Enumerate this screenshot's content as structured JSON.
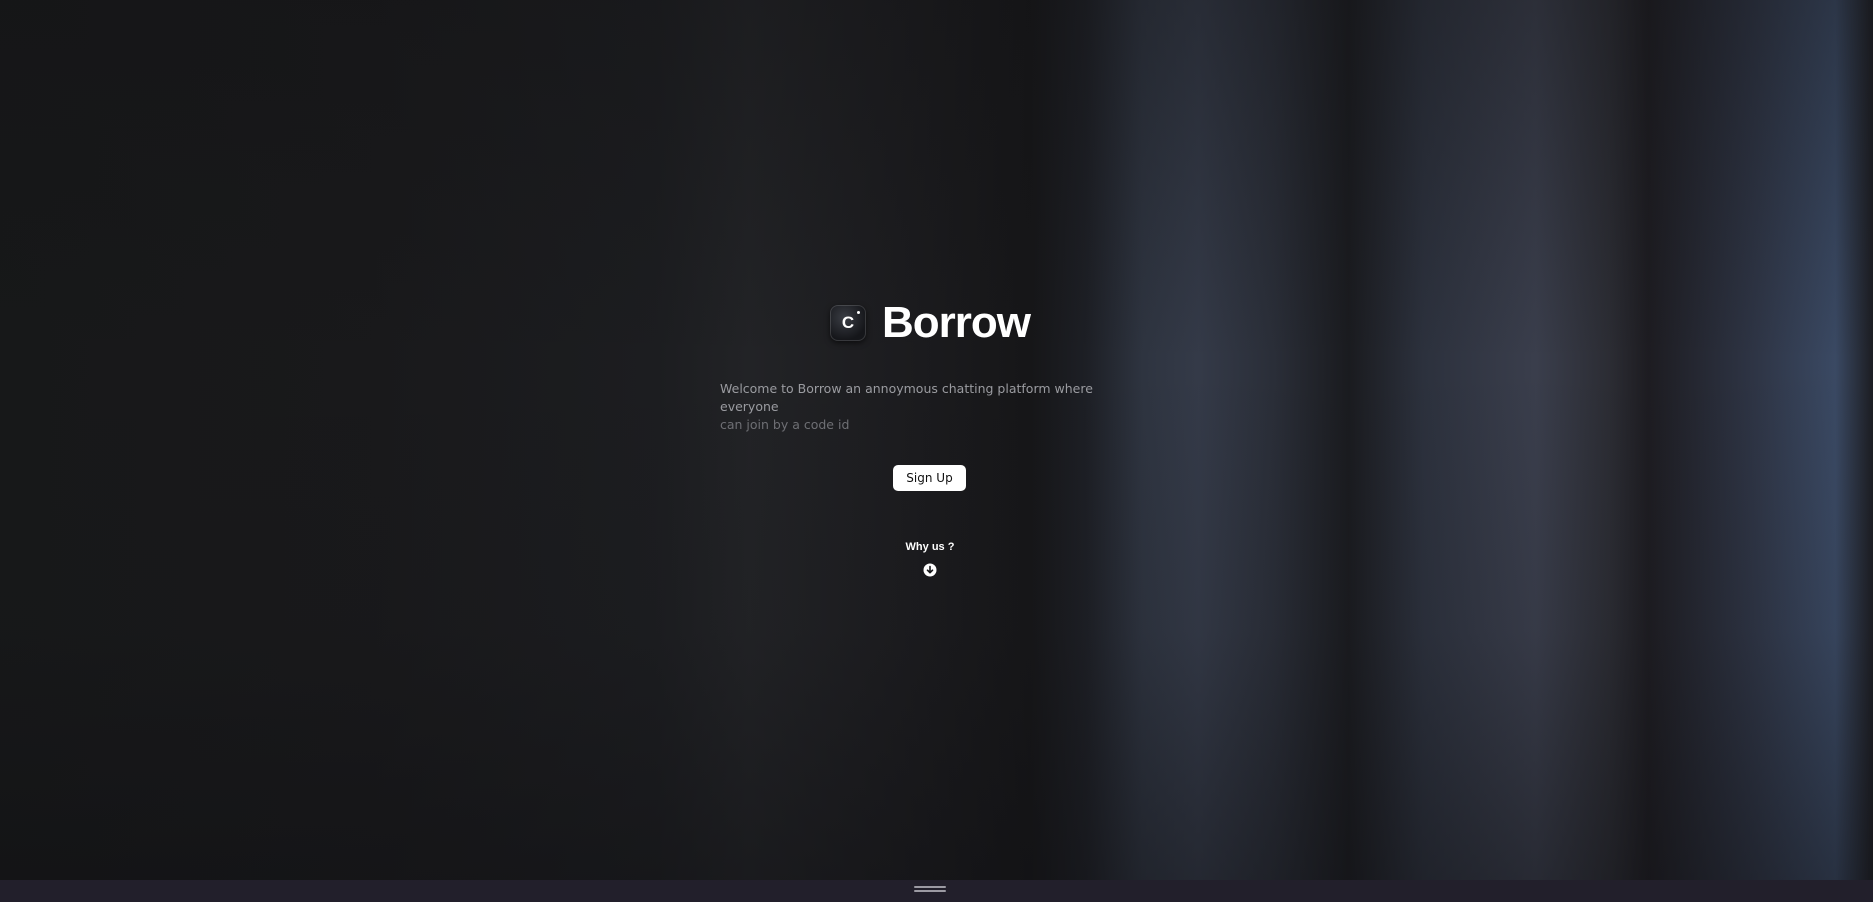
{
  "brand": {
    "logo_letter": "C",
    "logo_icon": "camera-c-logo",
    "name": "Borrow"
  },
  "hero": {
    "tagline_line1": "Welcome to Borrow an annoymous chatting platform where everyone",
    "tagline_line2": "can join by a code id",
    "signup_label": "Sign Up",
    "why_label": "Why us ?",
    "why_icon": "arrow-down-circle-icon"
  },
  "footer": {
    "handle_icon": "drag-handle-icon"
  },
  "colors": {
    "background": "#161719",
    "accent_button": "#ffffff",
    "bottom_bar": "#221f2b"
  }
}
